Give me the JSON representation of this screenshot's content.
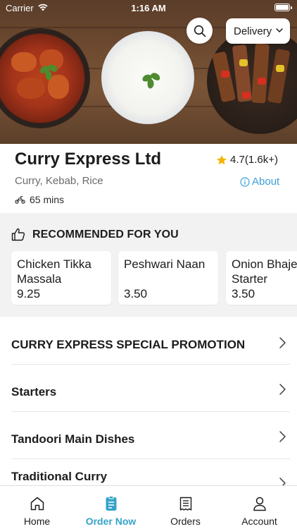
{
  "status_bar": {
    "carrier": "Carrier",
    "time": "1:16 AM"
  },
  "header": {
    "delivery_mode": "Delivery"
  },
  "restaurant": {
    "name": "Curry Express Ltd",
    "cuisine": "Curry, Kebab, Rice",
    "eta": "65 mins",
    "rating": "4.7(1.6k+)",
    "about_label": "About"
  },
  "recommended": {
    "title": "RECOMMENDED FOR YOU",
    "items": [
      {
        "name": "Chicken Tikka Massala",
        "price": "9.25"
      },
      {
        "name": "Peshwari Naan",
        "price": "3.50"
      },
      {
        "name": "Onion Bhaje Starter",
        "price": "3.50"
      }
    ]
  },
  "categories": [
    {
      "label": "CURRY EXPRESS SPECIAL PROMOTION"
    },
    {
      "label": "Starters"
    },
    {
      "label": "Tandoori Main Dishes"
    },
    {
      "label": "Traditional Curry"
    }
  ],
  "tabs": [
    {
      "label": "Home",
      "icon": "home-icon",
      "active": false
    },
    {
      "label": "Order Now",
      "icon": "order-icon",
      "active": true
    },
    {
      "label": "Orders",
      "icon": "receipt-icon",
      "active": false
    },
    {
      "label": "Account",
      "icon": "user-icon",
      "active": false
    }
  ],
  "colors": {
    "accent": "#36a3c9",
    "link": "#3aa0d8",
    "star": "#f5b400",
    "section_bg": "#f2f2f2"
  }
}
